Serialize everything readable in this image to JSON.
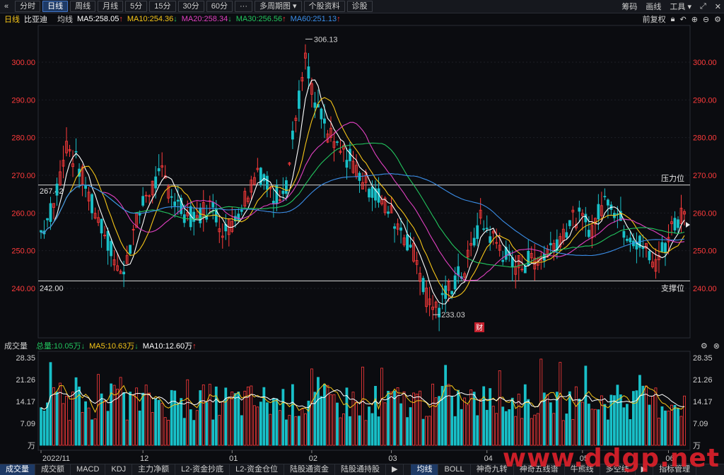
{
  "toolbar": {
    "back_icon": "«",
    "tabs": [
      "分时",
      "日线",
      "周线",
      "月线",
      "5分",
      "15分",
      "30分",
      "60分",
      "···",
      "多周期图 ▾",
      "个股资料",
      "诊股"
    ],
    "active_tab": 1,
    "right": [
      "筹码",
      "画线",
      "工具 ▾"
    ]
  },
  "info": {
    "period": "日线",
    "name": "比亚迪",
    "ma_label": "均线",
    "ma": [
      {
        "text": "MA5:258.05",
        "arrow": "↑",
        "arrow_color": "#ff3b3b",
        "color": "#ffffff"
      },
      {
        "text": "MA10:254.36",
        "arrow": "↓",
        "arrow_color": "#22c55e",
        "color": "#f5c518"
      },
      {
        "text": "MA20:258.34",
        "arrow": "↓",
        "arrow_color": "#22c55e",
        "color": "#e040c0"
      },
      {
        "text": "MA30:256.56",
        "arrow": "↑",
        "arrow_color": "#ff3b3b",
        "color": "#22c55e"
      },
      {
        "text": "MA60:251.13",
        "arrow": "↑",
        "arrow_color": "#ff3b3b",
        "color": "#3b8ee8"
      }
    ],
    "right_label": "前复权"
  },
  "price_axis": {
    "ticks": [
      "300.00",
      "290.00",
      "280.00",
      "270.00",
      "260.00",
      "250.00",
      "240.00"
    ]
  },
  "annotations": {
    "high": "306.13",
    "low": "233.03",
    "resist_value": "267.42",
    "support_value": "242.00",
    "resist_label": "压力位",
    "support_label": "支撑位",
    "fin_badge": "财"
  },
  "volume": {
    "title": "成交量",
    "total": "总量:10.05万",
    "total_arrow": "↓",
    "ma5": "MA5:10.63万",
    "ma5_arrow": "↓",
    "ma10": "MA10:12.60万",
    "ma10_arrow": "↑",
    "ticks": [
      "28.35",
      "21.26",
      "14.17",
      "7.09",
      "万"
    ]
  },
  "date_labels": [
    "2022/11",
    "12",
    "01",
    "02",
    "03",
    "04",
    "05",
    "06"
  ],
  "bottom_tabs": [
    "成交量",
    "成交额",
    "MACD",
    "KDJ",
    "主力净额",
    "L2-资金抄底",
    "L2-资金仓位",
    "陆股通资金",
    "陆股通持股",
    "▶",
    "均线",
    "BOLL",
    "神奇九转",
    "神奇五线谱",
    "牛熊线",
    "多空线",
    "▶",
    "指标管理"
  ],
  "bottom_active": [
    0,
    10
  ],
  "watermark": "www.ddgp.net",
  "colors": {
    "up": "#ff3b3b",
    "down": "#19c0c8",
    "ma5": "#ffffff",
    "ma10": "#f5c518",
    "ma20": "#e040c0",
    "ma30": "#22c55e",
    "ma60": "#3b8ee8"
  }
}
